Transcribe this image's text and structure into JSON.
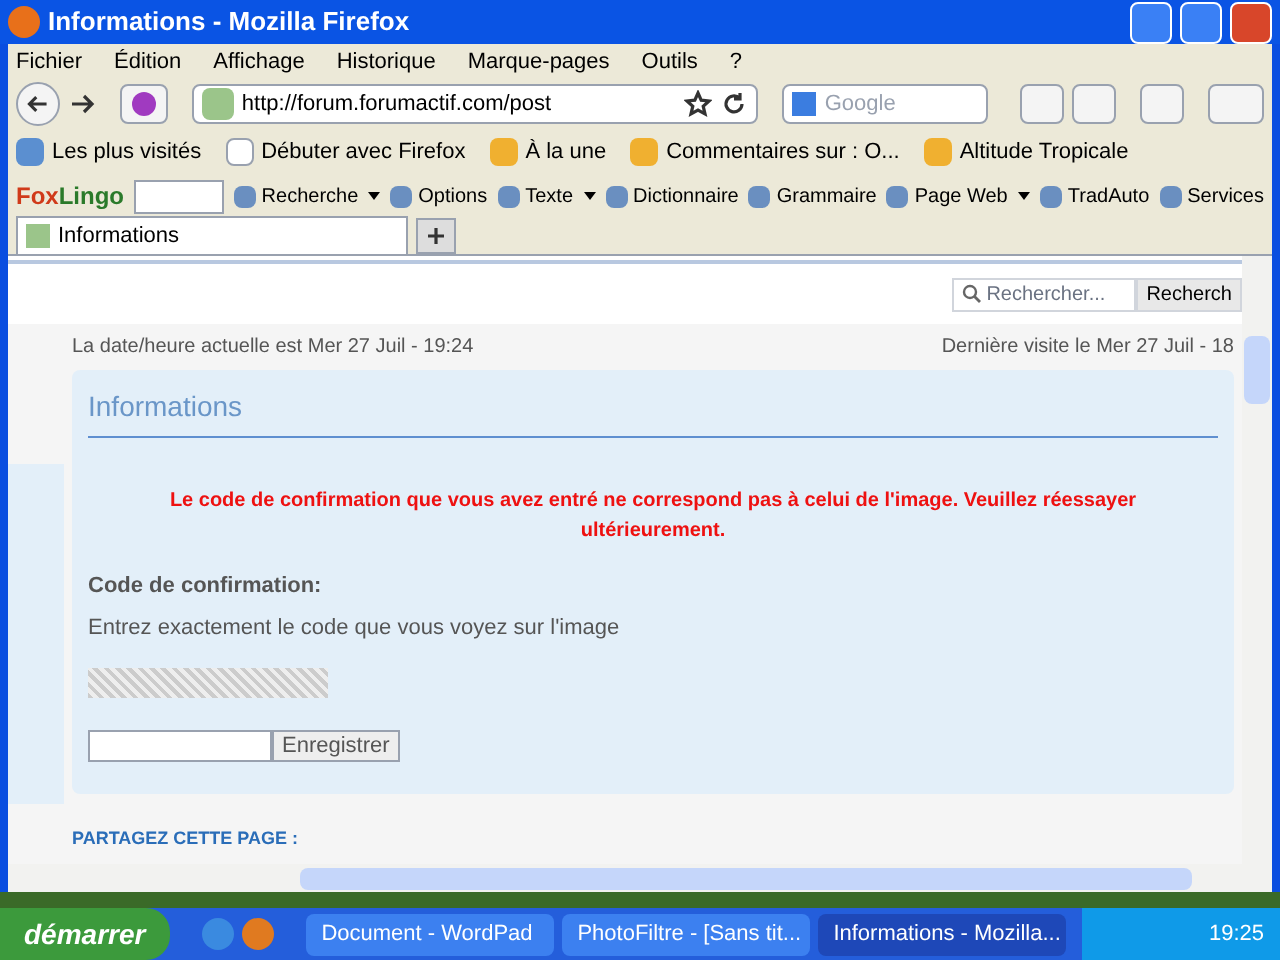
{
  "window": {
    "title": "Informations - Mozilla Firefox"
  },
  "menu": [
    "Fichier",
    "Édition",
    "Affichage",
    "Historique",
    "Marque-pages",
    "Outils",
    "?"
  ],
  "address": {
    "value": "http://forum.forumactif.com/post"
  },
  "search_engine": {
    "placeholder": "Google"
  },
  "bookmarks": [
    {
      "label": "Les plus visités",
      "kind": "search"
    },
    {
      "label": "Débuter avec Firefox",
      "kind": "page"
    },
    {
      "label": "À la une",
      "kind": "feed"
    },
    {
      "label": "Commentaires sur : O...",
      "kind": "feed"
    },
    {
      "label": "Altitude Tropicale",
      "kind": "feed"
    }
  ],
  "foxlingo": {
    "logo_a": "Fox",
    "logo_b": "Lingo",
    "items": [
      {
        "label": "Recherche",
        "dropdown": true
      },
      {
        "label": "Options",
        "dropdown": false
      },
      {
        "label": "Texte",
        "dropdown": true
      },
      {
        "label": "Dictionnaire",
        "dropdown": false
      },
      {
        "label": "Grammaire",
        "dropdown": false
      },
      {
        "label": "Page Web",
        "dropdown": true
      },
      {
        "label": "TradAuto",
        "dropdown": false
      },
      {
        "label": "Services",
        "dropdown": false
      }
    ]
  },
  "tabs": [
    {
      "label": "Informations",
      "selected": true
    }
  ],
  "page": {
    "search_placeholder": "Rechercher...",
    "search_button": "Recherch",
    "date_now": "La date/heure actuelle est Mer 27 Juil - 19:24",
    "last_visit": "Dernière visite le Mer 27 Juil - 18",
    "panel_title": "Informations",
    "error": "Le code de confirmation que vous avez entré ne correspond pas à celui de l'image. Veuillez réessayer ultérieurement.",
    "code_label": "Code de confirmation:",
    "code_hint": "Entrez exactement le code que vous voyez sur l'image",
    "submit": "Enregistrer",
    "share": "PARTAGEZ CETTE PAGE :"
  },
  "taskbar": {
    "start": "démarrer",
    "tasks": [
      {
        "label": "Document - WordPad",
        "selected": false
      },
      {
        "label": "PhotoFiltre - [Sans tit...",
        "selected": false
      },
      {
        "label": "Informations - Mozilla...",
        "selected": true
      }
    ],
    "clock": "19:25"
  }
}
